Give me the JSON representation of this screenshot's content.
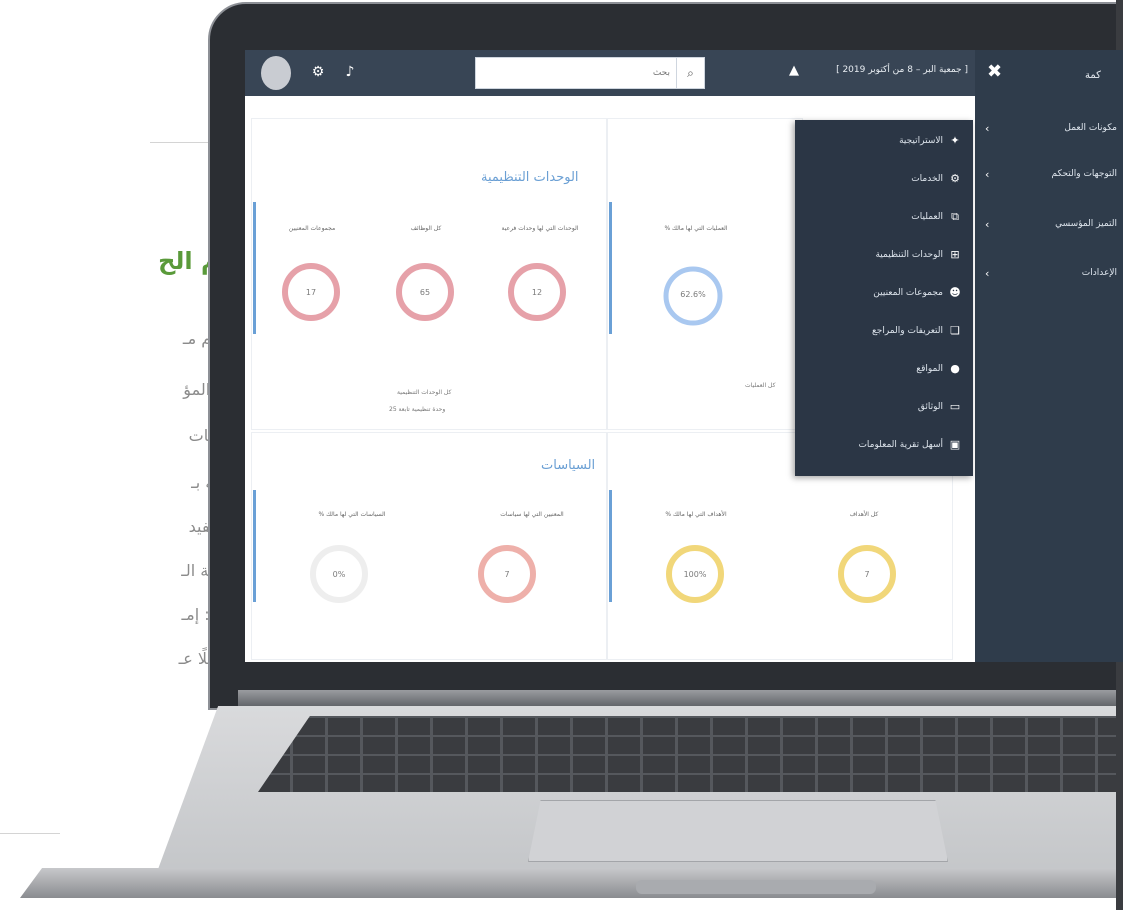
{
  "page": {
    "title_partial": "نظام الح",
    "lines": [
      "مـن أهـم مـ",
      "والتميز المؤ",
      "السياسـات ",
      "الجمعيـة  بـ",
      "والمسـتفيد",
      "مصفوفـة الـ",
      "المكتبـة: إمـ",
      "pdf فضلًا عـ"
    ]
  },
  "app": {
    "topbar": {
      "search_placeholder": "بحث",
      "context_text": "[ جمعية البر – 8 من أكتوبر 2019 ]",
      "close_icon": "✖"
    },
    "sidebar": {
      "title": "كمة",
      "items": [
        {
          "label": "مكونات العمل"
        },
        {
          "label": "التوجهات والتحكم"
        },
        {
          "label": "التميز المؤسسي"
        },
        {
          "label": "الإعدادات"
        }
      ]
    },
    "menu": {
      "items": [
        {
          "label": "الاستراتيجية",
          "icon": "lightbulb-icon"
        },
        {
          "label": "الخدمات",
          "icon": "gears-icon"
        },
        {
          "label": "العمليات",
          "icon": "process-icon"
        },
        {
          "label": "الوحدات التنظيمية",
          "icon": "org-chart-icon"
        },
        {
          "label": "مجموعات المعنيين",
          "icon": "group-icon"
        },
        {
          "label": "التعريفات والمراجع",
          "icon": "book-icon"
        },
        {
          "label": "المواقع",
          "icon": "map-pin-icon"
        },
        {
          "label": "الوثائق",
          "icon": "document-icon"
        },
        {
          "label": "أسهل تقرية المعلومات",
          "icon": "report-icon"
        }
      ]
    },
    "panels": {
      "units": {
        "title": "الوحدات التنظيمية",
        "metrics": [
          {
            "label": "الوحدات التي لها وحدات فرعية",
            "value": "12",
            "color": "#e6a1a9"
          },
          {
            "label": "كل الوظائف",
            "value": "65",
            "color": "#e6a1a9"
          },
          {
            "label": "مجموعات المعنيين",
            "value": "17",
            "color": "#e6a1a9"
          }
        ],
        "footer_label": "كل الوحدات التنظيمية",
        "footer_sub": "وحدة تنظيمية تابعة 25"
      },
      "processes": {
        "metric": {
          "label": "العمليات التي لها مالك %",
          "value": "62.6%",
          "color": "#a9c8f0"
        },
        "footer_label": "كل العمليات"
      },
      "policies": {
        "title": "السياسات",
        "metrics": [
          {
            "label": "المعنيين التي لها سياسات",
            "value": "7",
            "color": "#eeb0aa"
          },
          {
            "label": "السياسات التي لها مالك %",
            "value": "0%",
            "color": "#eeeeee"
          }
        ]
      },
      "goals": {
        "metrics": [
          {
            "label": "كل الأهداف",
            "value": "7",
            "color": "#f1d77a"
          },
          {
            "label": "الأهداف التي لها مالك %",
            "value": "100%",
            "color": "#f1d77a"
          }
        ]
      }
    }
  }
}
